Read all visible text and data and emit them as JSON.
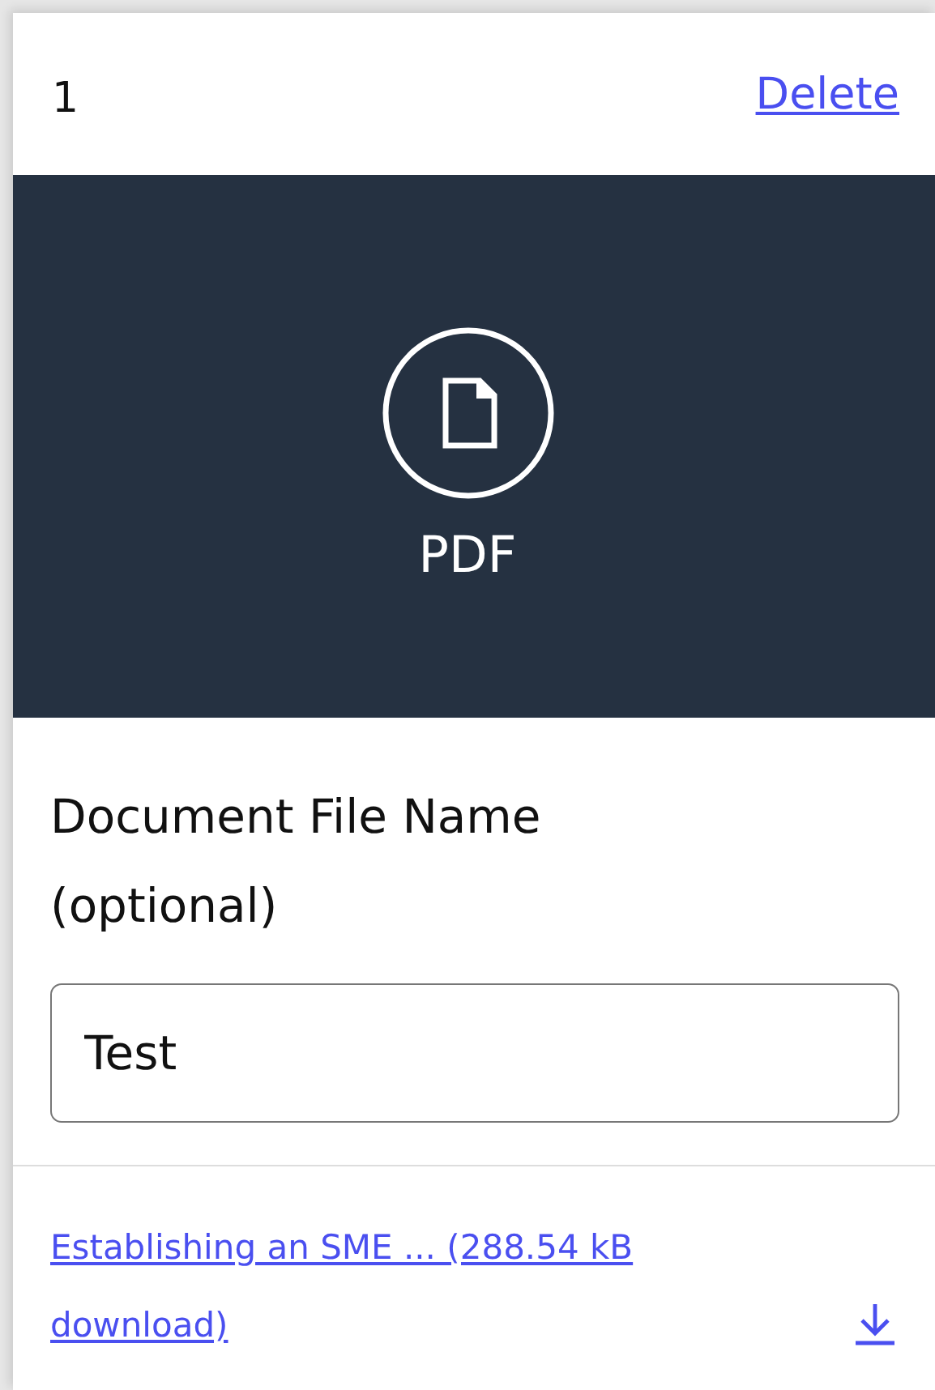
{
  "header": {
    "number": "1",
    "delete_link": "Delete"
  },
  "preview": {
    "file_type": "PDF"
  },
  "file_name_field": {
    "label": "Document File Name (optional)",
    "value": "Test"
  },
  "download": {
    "link": "Establishing an SME ... (288.54 kB download)"
  }
}
